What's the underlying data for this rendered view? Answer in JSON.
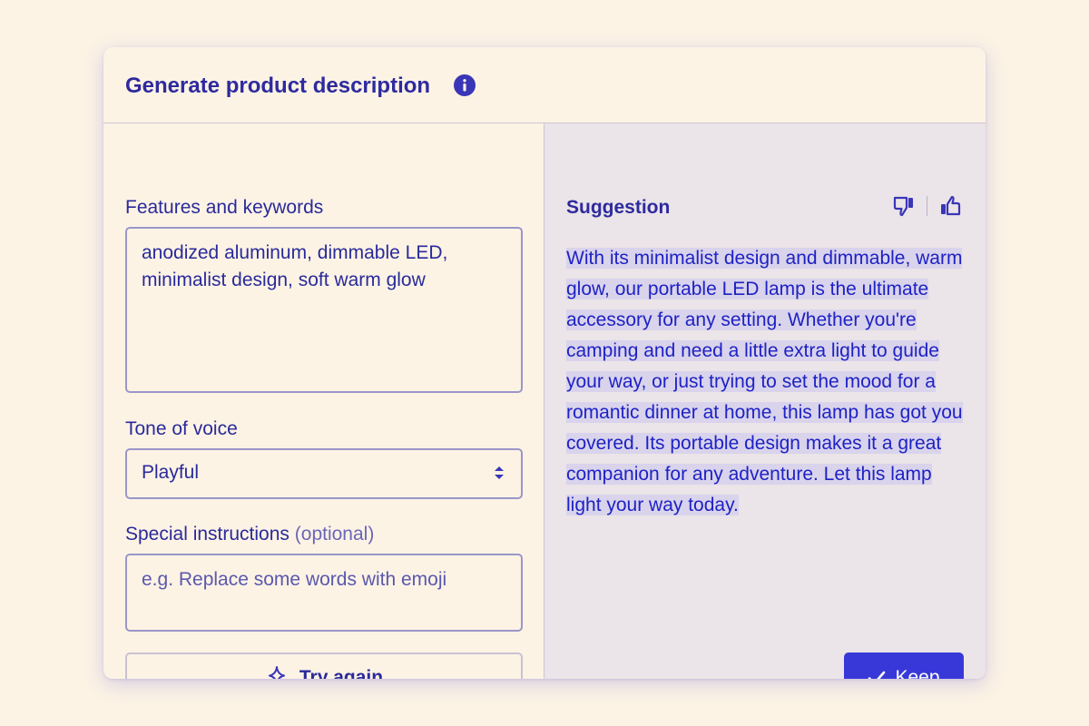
{
  "header": {
    "title": "Generate product description",
    "info_icon": "info-icon"
  },
  "form": {
    "features": {
      "label": "Features and keywords",
      "value": "anodized aluminum, dimmable LED, minimalist design, soft warm glow"
    },
    "tone": {
      "label": "Tone of voice",
      "selected": "Playful"
    },
    "instructions": {
      "label": "Special instructions",
      "label_optional": "(optional)",
      "placeholder": "e.g. Replace some words with emoji"
    },
    "try_again_label": "Try again",
    "try_again_icon": "sparkles-icon"
  },
  "suggestion": {
    "label": "Suggestion",
    "text": "With its minimalist design and dimmable, warm glow, our portable LED lamp is the ultimate accessory for any setting. Whether you're camping and need a little extra light to guide your way, or just trying to set the mood for a romantic dinner at home, this lamp has got you covered. Its portable design makes it a great companion for any adventure. Let this lamp light your way today.",
    "thumbs_down_icon": "thumbs-down-icon",
    "thumbs_up_icon": "thumbs-up-icon",
    "keep_label": "Keep",
    "keep_icon": "check-icon"
  },
  "colors": {
    "background": "#fcf3e5",
    "accent": "#3838d9",
    "text": "#2a2a9a",
    "suggestion_bg": "#ebe4e8",
    "highlight": "#d9d3ec"
  }
}
